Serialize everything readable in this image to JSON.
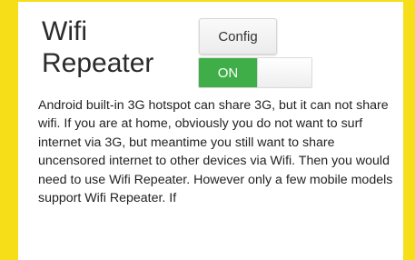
{
  "page": {
    "title_line1": "Wifi",
    "title_line2": "Repeater",
    "config_button_label": "Config",
    "toggle": {
      "label": "ON",
      "state": "on",
      "active_color": "#3FAE49"
    },
    "description": "Android built-in 3G hotspot can share 3G, but it can not share wifi. If you are at home, obviously you do not want to surf internet via 3G, but meantime you still want to share uncensored internet to other devices via Wifi. Then you would need to use Wifi Repeater. However only a few mobile models support Wifi Repeater. If"
  },
  "colors": {
    "background": "#F6DF18",
    "panel": "#FFFFFF"
  }
}
